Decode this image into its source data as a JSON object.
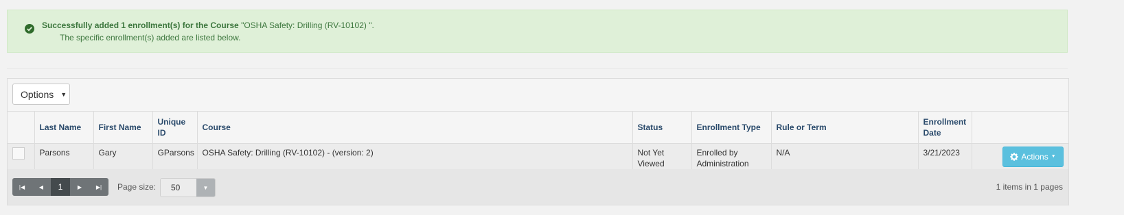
{
  "alert": {
    "bold_text": "Successfully added 1 enrollment(s) for the Course ",
    "course_text": "\"OSHA Safety: Drilling (RV-10102) \".",
    "detail_text": "The specific enrollment(s) added are listed below.",
    "icon": "check-circle-icon",
    "color": "#3c763d"
  },
  "toolbar": {
    "options_label": "Options"
  },
  "table": {
    "columns": {
      "last_name": "Last Name",
      "first_name": "First Name",
      "unique_id": "Unique ID",
      "course": "Course",
      "status": "Status",
      "enrollment_type": "Enrollment Type",
      "rule_or_term": "Rule or Term",
      "enrollment_date": "Enrollment Date"
    },
    "rows": [
      {
        "last_name": "Parsons",
        "first_name": "Gary",
        "unique_id": "GParsons",
        "course": "OSHA Safety: Drilling (RV-10102) - (version: 2)",
        "status": "Not Yet Viewed",
        "enrollment_type": "Enrolled by Administration",
        "rule_or_term": "N/A",
        "enrollment_date": "3/21/2023",
        "actions_label": "Actions"
      }
    ]
  },
  "pager": {
    "current_page": "1",
    "page_size_label": "Page size:",
    "page_size_value": "50",
    "info": "1 items in 1 pages"
  },
  "colors": {
    "actions_button": "#5bc0de",
    "alert_bg": "#dff0d8"
  }
}
